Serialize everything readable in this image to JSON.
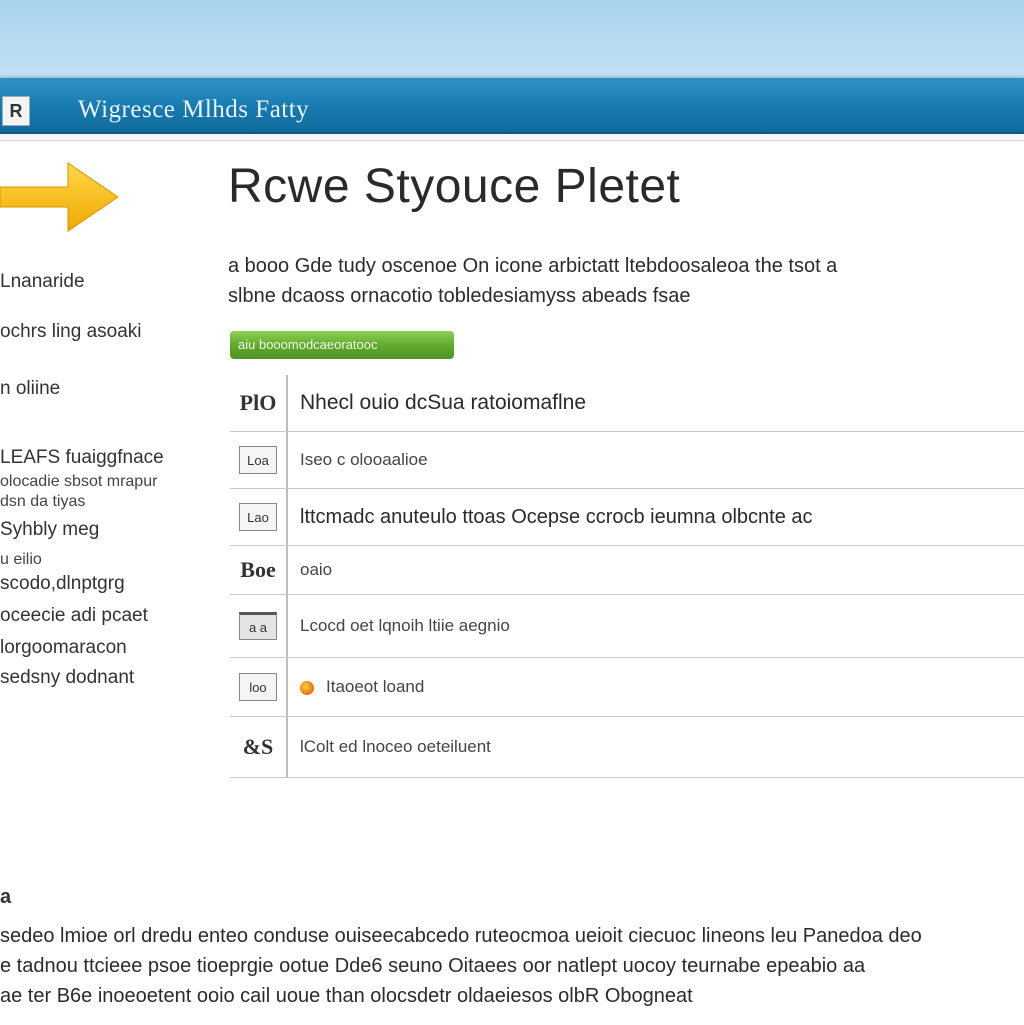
{
  "window": {
    "title": "Wigresce Mlhds Fatty",
    "icon_label": "R"
  },
  "sidebar": {
    "arrow_icon": "arrow-right-icon",
    "arrow_color": "#f5b800",
    "items": [
      {
        "label": "Lnanaride"
      },
      {
        "label": "ochrs ling asoaki"
      },
      {
        "label": "n oliine"
      },
      {
        "label": "LEAFS fuaiggfnace"
      },
      {
        "label": "olocadie sbsot mrapur"
      },
      {
        "label": "dsn da tiyas"
      },
      {
        "label": "Syhbly meg"
      },
      {
        "label": "u eilio"
      },
      {
        "label": "scodo,dlnptgrg"
      },
      {
        "label": "oceecie adi pcaet"
      },
      {
        "label": "lorgoomaracon"
      },
      {
        "label": "sedsny dodnant"
      }
    ]
  },
  "main": {
    "heading": "Rcwe Styouce Pletet",
    "intro": "a booo Gde tudy oscenoe On icone arbictatt ltebdoosaleoa the tsot a\nslbne dcaoss ornacotio tobledesiamyss abeads fsae",
    "progress": {
      "label": "aiu booomodcaeoratooc",
      "value_percent": 100,
      "color": "#5fa82b"
    },
    "rows": [
      {
        "icon_name": "file-icon",
        "icon_text": "PlO",
        "text": "Nhecl ouio dcSua ratoiomaflne"
      },
      {
        "icon_name": "document-icon",
        "icon_text": "Loa",
        "text": "Iseo c olooaalioe"
      },
      {
        "icon_name": "image-icon",
        "icon_text": "Lao",
        "text": "lttcmadc anuteulo ttoas Ocepse ccrocb ieumna olbcnte ac"
      },
      {
        "icon_name": "text-icon",
        "icon_text": "Boe",
        "text": "oaio"
      },
      {
        "icon_name": "folder-icon",
        "icon_text": "a a",
        "text": "Lcocd oet lqnoih ltiie aegnio"
      },
      {
        "icon_name": "grid-icon",
        "icon_text": "loo",
        "text": "Itaoeot loand",
        "status": "warning",
        "status_color": "#f07a10"
      },
      {
        "icon_name": "settings-icon",
        "icon_text": "&S",
        "text": "lColt ed lnoceo oeteiluent"
      }
    ]
  },
  "footer": {
    "section_mark": "a",
    "text": "sedeo lmioe orl dredu enteo conduse ouiseecabcedo ruteocmoa ueioit ciecuoc lineons leu Panedoa deo\ne tadnou ttcieee psoe tioeprgie  ootue Dde6 seuno Oitaees oor natlept uocoy teurnabe epeabio aa\nae ter B6e inoeoetent ooio cail uoue than olocsdetr oldaeiesos olbR Obogneat"
  }
}
